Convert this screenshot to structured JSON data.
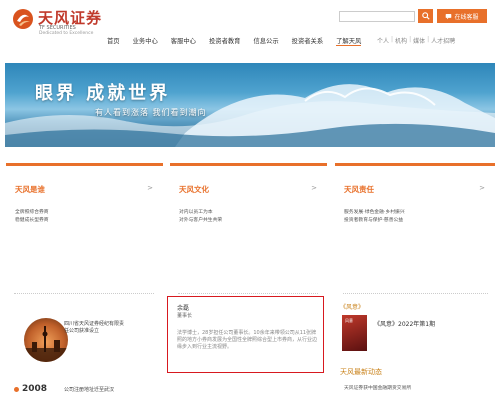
{
  "logo": {
    "name": "天风证券",
    "en": "TF SECURITIES",
    "tagline": "Dedicated to Excellence"
  },
  "search": {
    "placeholder": ""
  },
  "online_service_label": "在线客服",
  "nav": {
    "items": [
      "首页",
      "业务中心",
      "客服中心",
      "投资者教育",
      "信息公示",
      "投资者关系",
      "了解天风"
    ]
  },
  "subnav": {
    "items": [
      "个人",
      "机构",
      "媒体",
      "人才招聘"
    ]
  },
  "banner": {
    "title": "眼界 成就世界",
    "subtitle": "有人看到涨落 我们看到潮向"
  },
  "cards": [
    {
      "title": "天风是谁",
      "links": [
        "全牌照综合券商",
        "稳健成长型券商"
      ]
    },
    {
      "title": "天风文化",
      "links": [
        "对内以员工为本",
        "对外与客户共生共荣"
      ]
    },
    {
      "title": "天风责任",
      "links": [
        "服务发展·绿色金融·乡村振兴",
        "投资者教育与保护·慈善公益"
      ]
    }
  ],
  "timeline": {
    "event_text": "四川省天风证券经纪有限责任公司获准设立",
    "year": "2008",
    "next_text": "公司注册地址迁至武汉"
  },
  "person": {
    "name": "余磊",
    "title": "董事长",
    "bio": "法学博士，28岁担任公司董事长。10余年来带领公司从11张牌照的地方小券商发展为全国性全牌照综合型上市券商，从行业边缘步入到行业主流视野。"
  },
  "magazine": {
    "header": "《风意》",
    "title": "《风意》2022年第1期",
    "cover_text": "风意"
  },
  "news": {
    "header": "天风最新动态",
    "item": "天风证券获中国金融期货交易所"
  }
}
